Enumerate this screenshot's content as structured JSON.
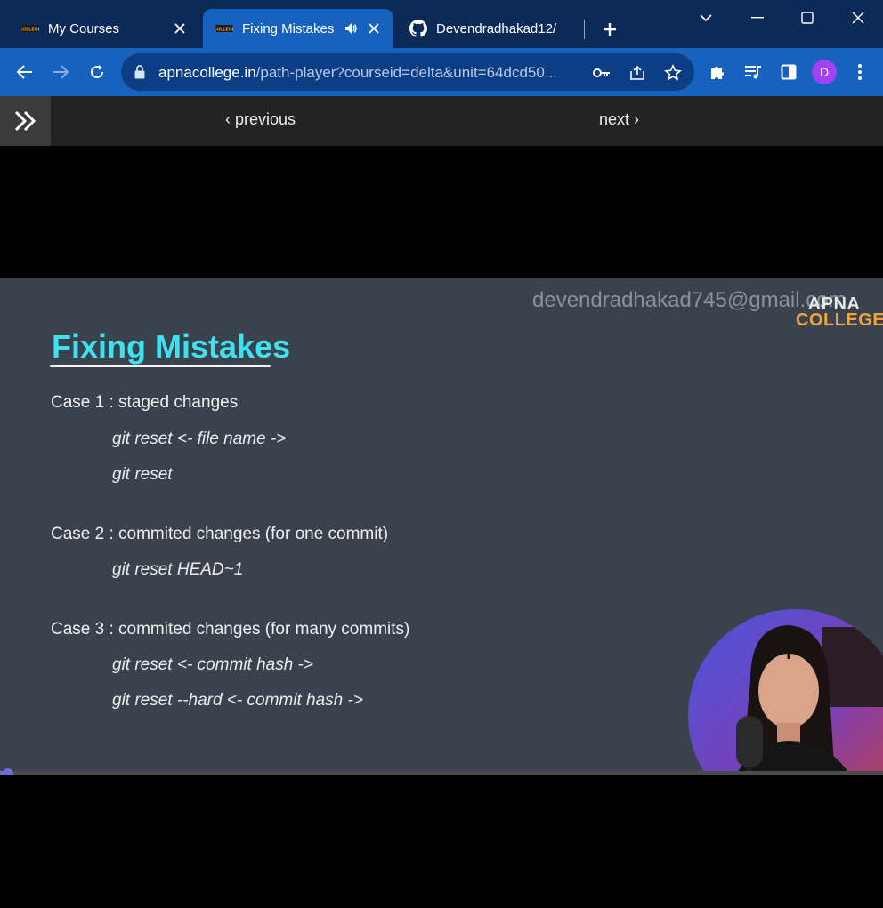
{
  "tabs": [
    {
      "label": "My Courses",
      "state": "inactive",
      "favicon": "apna-college-favicon"
    },
    {
      "label": "Fixing Mistakes",
      "state": "active",
      "favicon": "apna-college-favicon",
      "audio": true
    },
    {
      "label": "Devendradhakad12/",
      "state": "inactive",
      "favicon": "github-icon"
    }
  ],
  "address_bar": {
    "domain": "apnacollege.in",
    "path": "/path-player?courseid=delta&unit=64dcd50..."
  },
  "profile": {
    "initial": "D",
    "color": "#a142f4"
  },
  "page_nav": {
    "previous_label": "previous",
    "next_label": "next"
  },
  "slide": {
    "watermark": "devendradhakad745@gmail.com",
    "logo_line1": "APNA",
    "logo_line2": "COLLEGE",
    "title": "Fixing Mistakes",
    "cases": [
      {
        "heading": "Case 1 : staged changes",
        "commands": [
          "git reset <- file name ->",
          "git reset"
        ]
      },
      {
        "heading": "Case 2 : commited changes (for one commit)",
        "commands": [
          "git reset HEAD~1"
        ]
      },
      {
        "heading": "Case 3 : commited changes (for many commits)",
        "commands": [
          "git reset <- commit hash ->",
          "git reset --hard <- commit hash ->"
        ]
      }
    ]
  },
  "video": {
    "progress_percent": 0.5
  },
  "colors": {
    "tabstrip_bg": "#0c2a57",
    "toolbar_bg": "#1762bf",
    "slide_bg": "#3a424d",
    "title_color": "#3fe0ef",
    "logo_accent": "#f2a33a",
    "progress_color": "#6a6fd8"
  }
}
